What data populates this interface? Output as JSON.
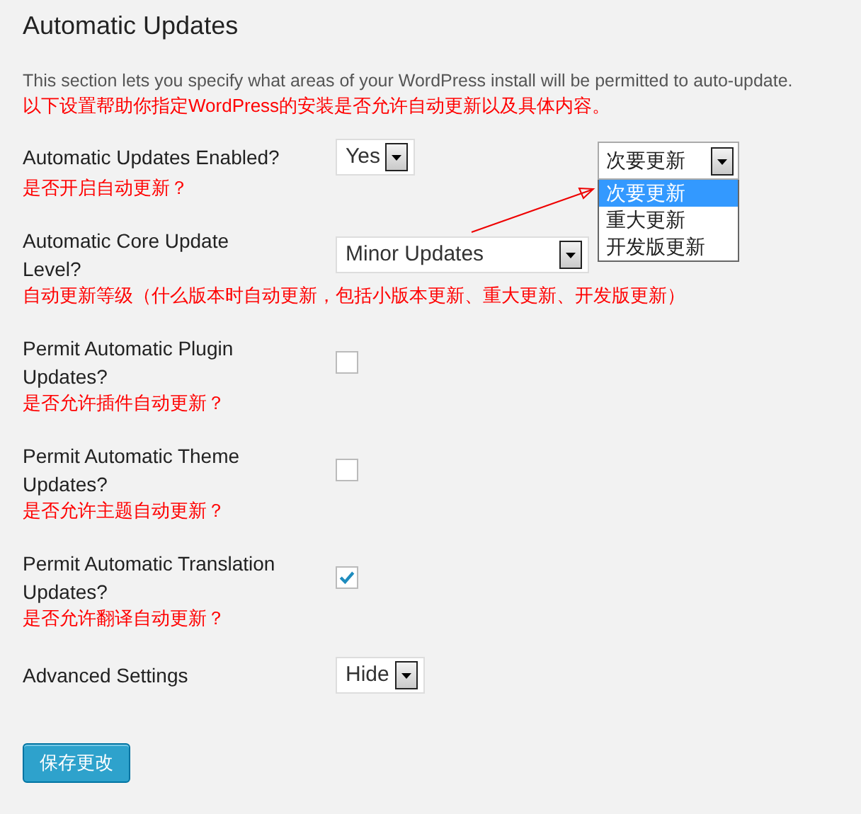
{
  "section": {
    "title": "Automatic Updates",
    "description": "This section lets you specify what areas of your WordPress install will be permitted to auto-update.",
    "description_zh": "以下设置帮助你指定WordPress的安装是否允许自动更新以及具体内容。"
  },
  "settings": [
    {
      "kind": "select",
      "label": "Automatic Updates Enabled?",
      "note": "是否开启自动更新？",
      "value": "Yes"
    },
    {
      "kind": "select",
      "label": "Automatic Core Update Level?",
      "note": "自动更新等级（什么版本时自动更新，包括小版本更新、重大更新、开发版更新）",
      "value": "Minor Updates"
    },
    {
      "kind": "checkbox",
      "label": "Permit Automatic Plugin Updates?",
      "note": "是否允许插件自动更新？",
      "checked": false
    },
    {
      "kind": "checkbox",
      "label": "Permit Automatic Theme Updates?",
      "note": "是否允许主题自动更新？",
      "checked": false
    },
    {
      "kind": "checkbox",
      "label": "Permit Automatic Translation Updates?",
      "note": "是否允许翻译自动更新？",
      "checked": true
    },
    {
      "kind": "select",
      "label": "Advanced Settings",
      "value": "Hide"
    }
  ],
  "dropdown_callout": {
    "value": "次要更新",
    "options": [
      {
        "label": "次要更新",
        "selected": true
      },
      {
        "label": "重大更新",
        "selected": false
      },
      {
        "label": "开发版更新",
        "selected": false
      }
    ]
  },
  "save_button": "保存更改"
}
